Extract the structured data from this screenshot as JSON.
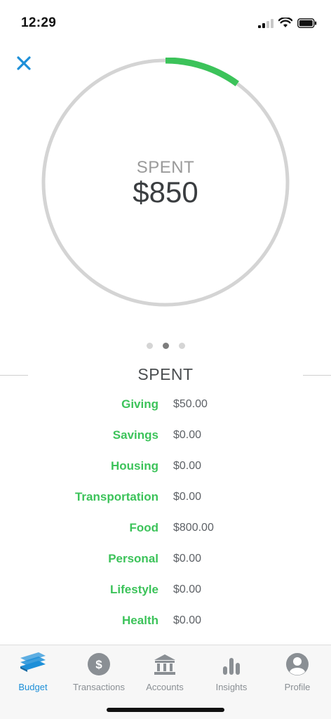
{
  "status": {
    "time": "12:29"
  },
  "progress": {
    "label": "SPENT",
    "amount": "$850",
    "fraction": 0.1
  },
  "pager": {
    "count": 3,
    "active_index": 1
  },
  "section": {
    "title": "SPENT"
  },
  "rows": [
    {
      "label": "Giving",
      "value": "$50.00"
    },
    {
      "label": "Savings",
      "value": "$0.00"
    },
    {
      "label": "Housing",
      "value": "$0.00"
    },
    {
      "label": "Transportation",
      "value": "$0.00"
    },
    {
      "label": "Food",
      "value": "$800.00"
    },
    {
      "label": "Personal",
      "value": "$0.00"
    },
    {
      "label": "Lifestyle",
      "value": "$0.00"
    },
    {
      "label": "Health",
      "value": "$0.00"
    }
  ],
  "tabs": [
    {
      "label": "Budget",
      "icon": "budget-icon"
    },
    {
      "label": "Transactions",
      "icon": "dollar-circle-icon"
    },
    {
      "label": "Accounts",
      "icon": "bank-icon"
    },
    {
      "label": "Insights",
      "icon": "bar-chart-icon"
    },
    {
      "label": "Profile",
      "icon": "profile-icon"
    }
  ],
  "colors": {
    "accent": "#3cc35a",
    "ring_track": "#d4d4d4",
    "active_tab": "#1d8fd8",
    "inactive_tab": "#8a8f94",
    "close": "#1d8fd8"
  }
}
